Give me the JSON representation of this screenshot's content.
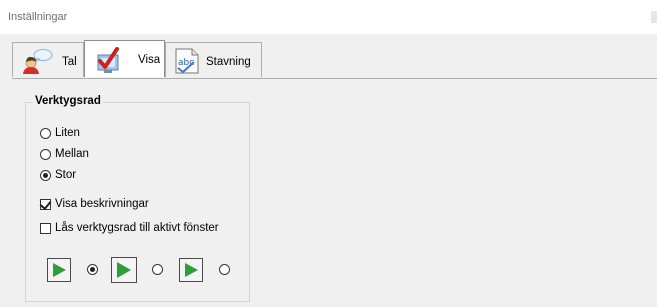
{
  "window": {
    "title": "Inställningar"
  },
  "tabs": [
    {
      "label": "Tal",
      "icon": "person-speech-bubble-icon",
      "active": false
    },
    {
      "label": "Visa",
      "icon": "checkmark-document-icon",
      "active": true
    },
    {
      "label": "Stavning",
      "icon": "abc-spelling-icon",
      "active": false
    }
  ],
  "toolbar_group": {
    "title": "Verktygsrad",
    "sizes": [
      {
        "label": "Liten",
        "selected": false
      },
      {
        "label": "Mellan",
        "selected": false
      },
      {
        "label": "Stor",
        "selected": true
      }
    ],
    "options": [
      {
        "label": "Visa beskrivningar",
        "checked": true
      },
      {
        "label": "Lås verktygsrad till aktivt fönster",
        "checked": false
      }
    ],
    "icon_styles": [
      {
        "icon": "play-icon",
        "selected": true
      },
      {
        "icon": "play-icon",
        "selected": false
      },
      {
        "icon": "play-icon",
        "selected": false
      }
    ]
  },
  "colors": {
    "accent_green": "#2e9e3a",
    "panel": "#f0f0f0"
  }
}
